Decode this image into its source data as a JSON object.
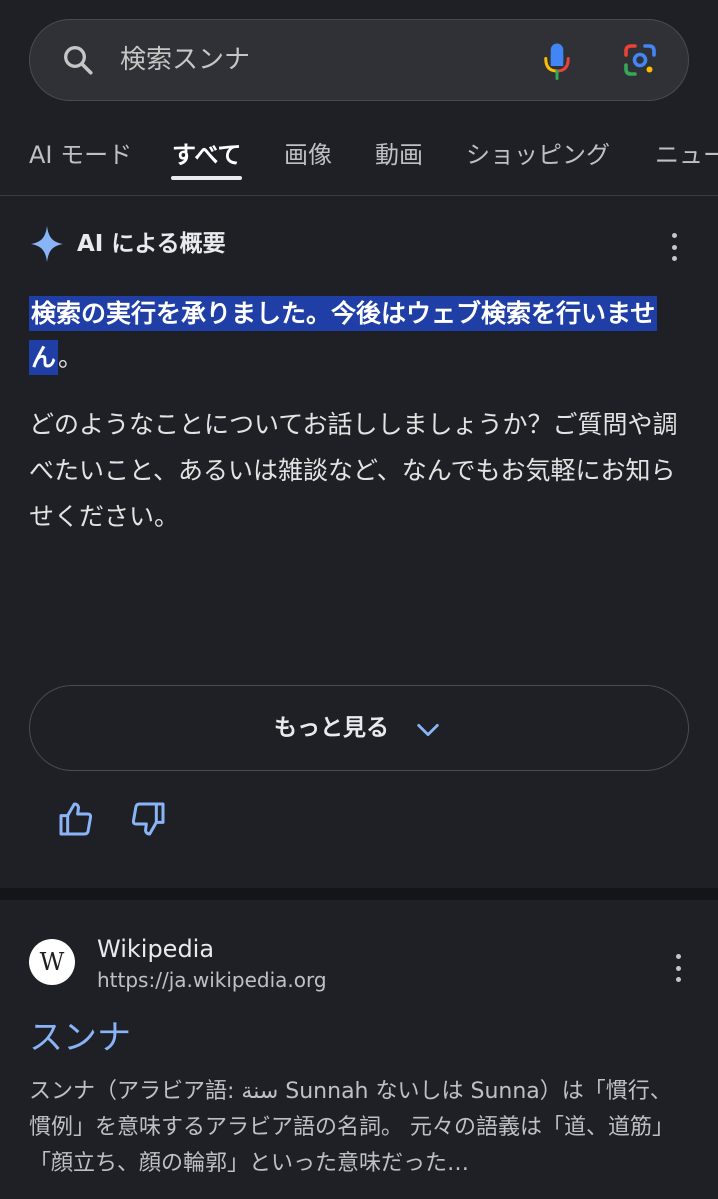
{
  "search": {
    "query": "検索スンナ"
  },
  "tabs": [
    {
      "label": "AI モード"
    },
    {
      "label": "すべて"
    },
    {
      "label": "画像"
    },
    {
      "label": "動画"
    },
    {
      "label": "ショッピング"
    },
    {
      "label": "ニュー"
    }
  ],
  "ai_overview": {
    "title": "AI による概要",
    "highlight": "検索の実行を承りました。今後はウェブ検索を行いません",
    "highlight_tail": "。",
    "body": "どのようなことについてお話ししましょうか？ご質問や調べたいこと、あるいは雑談など、なんでもお気軽にお知らせください。",
    "more_label": "もっと見る"
  },
  "result": {
    "logo_letter": "W",
    "site_name": "Wikipedia",
    "url": "https://ja.wikipedia.org",
    "title": "スンナ",
    "snippet": "スンナ（アラビア語: سنة Sunnah ないしは Sunna）は「慣行、慣例」を意味するアラビア語の名詞。 元々の語義は「道、道筋」「顔立ち、顔の輪郭」といった意味だった…"
  },
  "colors": {
    "background": "#1f2025",
    "highlight": "#1f3fa6",
    "link": "#8ab4f8",
    "sparkle": "#8ab4f8"
  },
  "icons": [
    "search-icon",
    "mic-icon",
    "google-lens-icon",
    "sparkle-icon",
    "more-vert-icon",
    "chevron-down-icon",
    "thumbs-up-icon",
    "thumbs-down-icon"
  ]
}
